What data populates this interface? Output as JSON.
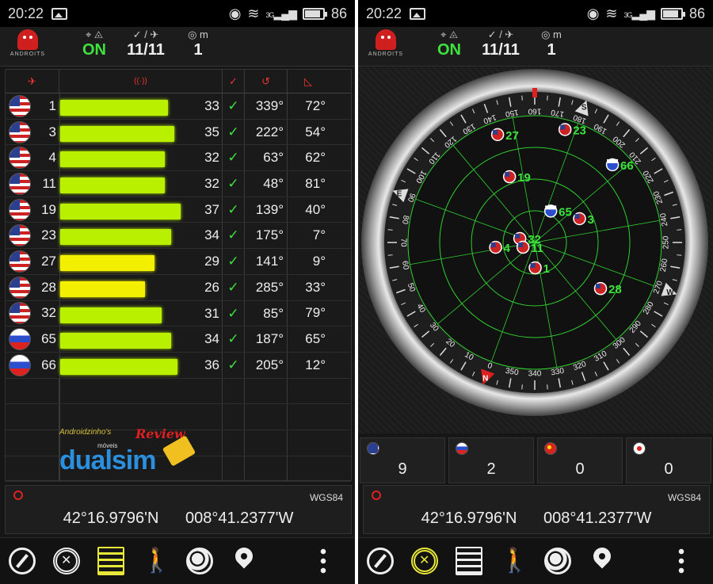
{
  "statusbar": {
    "time": "20:22",
    "network": "3G",
    "battery": "86"
  },
  "header": {
    "logo_text": "ANDROITS",
    "fix_icon": "⌖ ◬",
    "fix_status": "ON",
    "sats_icon": "✓ / ✈",
    "sats_used": "11/11",
    "accuracy_icon": "◎ m",
    "accuracy": "1"
  },
  "table": {
    "headers": {
      "sat": "✈",
      "snr": "((·))",
      "used": "✓",
      "azimuth": "↺",
      "elevation": "◺"
    },
    "rows": [
      {
        "flag": "us",
        "prn": "1",
        "snr": "33",
        "az": "339°",
        "el": "72°",
        "bar_color": "#b8f000",
        "snr_value": 33
      },
      {
        "flag": "us",
        "prn": "3",
        "snr": "35",
        "az": "222°",
        "el": "54°",
        "bar_color": "#b8f000",
        "snr_value": 35
      },
      {
        "flag": "us",
        "prn": "4",
        "snr": "32",
        "az": "63°",
        "el": "62°",
        "bar_color": "#b8f000",
        "snr_value": 32
      },
      {
        "flag": "us",
        "prn": "11",
        "snr": "32",
        "az": "48°",
        "el": "81°",
        "bar_color": "#b8f000",
        "snr_value": 32
      },
      {
        "flag": "us",
        "prn": "19",
        "snr": "37",
        "az": "139°",
        "el": "40°",
        "bar_color": "#b8f000",
        "snr_value": 37
      },
      {
        "flag": "us",
        "prn": "23",
        "snr": "34",
        "az": "175°",
        "el": "7°",
        "bar_color": "#b8f000",
        "snr_value": 34
      },
      {
        "flag": "us",
        "prn": "27",
        "snr": "29",
        "az": "141°",
        "el": "9°",
        "bar_color": "#f2f000",
        "snr_value": 29
      },
      {
        "flag": "us",
        "prn": "28",
        "snr": "26",
        "az": "285°",
        "el": "33°",
        "bar_color": "#f2f000",
        "snr_value": 26
      },
      {
        "flag": "us",
        "prn": "32",
        "snr": "31",
        "az": "85°",
        "el": "79°",
        "bar_color": "#b8f000",
        "snr_value": 31
      },
      {
        "flag": "ru",
        "prn": "65",
        "snr": "34",
        "az": "187°",
        "el": "65°",
        "bar_color": "#b8f000",
        "snr_value": 34
      },
      {
        "flag": "ru",
        "prn": "66",
        "snr": "36",
        "az": "205°",
        "el": "12°",
        "bar_color": "#b8f000",
        "snr_value": 36
      }
    ],
    "used_mark": "✓"
  },
  "watermark": {
    "small": "Androidzinho's",
    "review": "Review",
    "mid": "móveis",
    "big": "dualsim"
  },
  "coords": {
    "datum": "WGS84",
    "lat": "42°16.9796'N",
    "lon": "008°41.2377'W"
  },
  "radar": {
    "compass_letters": [
      "N",
      "E",
      "S",
      "W"
    ],
    "degree_labels": [
      "0",
      "10",
      "20",
      "30",
      "40",
      "50",
      "60",
      "70",
      "80",
      "90",
      "100",
      "110",
      "120",
      "130",
      "140",
      "150",
      "160",
      "170",
      "180",
      "190",
      "200",
      "210",
      "220",
      "230",
      "240",
      "250",
      "260",
      "270",
      "280",
      "290",
      "300",
      "310",
      "320",
      "330",
      "340",
      "350"
    ],
    "sats": [
      {
        "prn": "27",
        "flag": "us"
      },
      {
        "prn": "23",
        "flag": "us"
      },
      {
        "prn": "19",
        "flag": "us"
      },
      {
        "prn": "66",
        "flag": "ru"
      },
      {
        "prn": "65",
        "flag": "ru"
      },
      {
        "prn": "4",
        "flag": "us"
      },
      {
        "prn": "32",
        "flag": "us"
      },
      {
        "prn": "11",
        "flag": "us"
      },
      {
        "prn": "3",
        "flag": "us"
      },
      {
        "prn": "1",
        "flag": "us"
      },
      {
        "prn": "28",
        "flag": "us"
      }
    ]
  },
  "counts": [
    {
      "flag": "us",
      "value": "9"
    },
    {
      "flag": "ru",
      "value": "2"
    },
    {
      "flag": "cn",
      "value": "0"
    },
    {
      "flag": "jp",
      "value": "0"
    }
  ],
  "nav": [
    "compass-icon",
    "radar-icon",
    "signal-bars-icon",
    "walk-icon",
    "world-icon",
    "map-pin-icon",
    "more-icon"
  ],
  "colors": {
    "accent_green": "#3ee23e",
    "accent_red": "#e33333",
    "bar_green": "#b8f000",
    "bar_yellow": "#f2f000",
    "radar_green": "#2fd02f"
  }
}
